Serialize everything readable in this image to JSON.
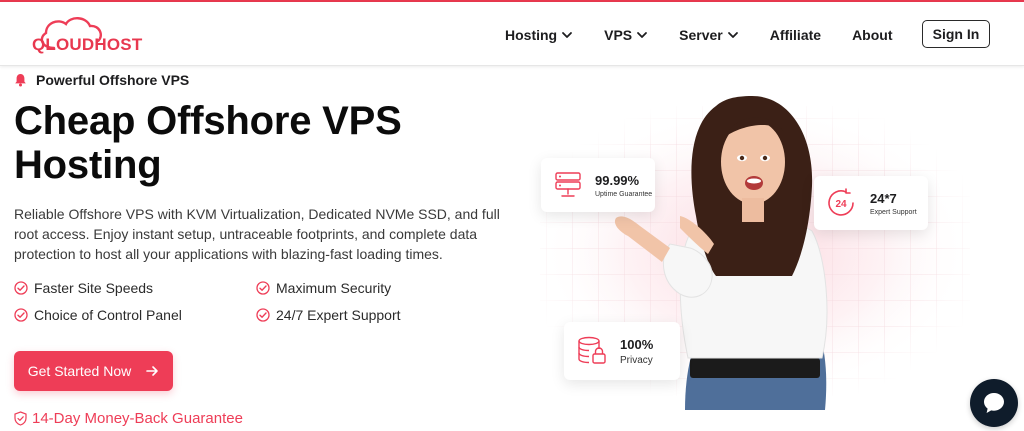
{
  "brand": {
    "logo_text": "QLOUDHOST",
    "accent": "#ee3d57",
    "dark": "#0f1c2b"
  },
  "nav": {
    "items": [
      {
        "label": "Hosting",
        "dropdown": true
      },
      {
        "label": "VPS",
        "dropdown": true
      },
      {
        "label": "Server",
        "dropdown": true
      },
      {
        "label": "Affiliate",
        "dropdown": false
      },
      {
        "label": "About",
        "dropdown": false
      }
    ],
    "signin_label": "Sign In"
  },
  "hero": {
    "eyebrow": "Powerful Offshore VPS",
    "title": "Cheap Offshore VPS Hosting",
    "description": "Reliable Offshore VPS with KVM Virtualization, Dedicated NVMe SSD, and full root access. Enjoy instant setup, untraceable footprints, and complete data protection to host all your applications with blazing-fast loading times.",
    "features": [
      "Faster Site Speeds",
      "Maximum Security",
      "Choice of Control Panel",
      "24/7 Expert Support"
    ],
    "cta_label": "Get Started Now",
    "guarantee": "14-Day Money-Back Guarantee"
  },
  "stats": {
    "uptime": {
      "value": "99.99%",
      "label": "Uptime Guarantee"
    },
    "support": {
      "value": "24*7",
      "label": "Expert Support",
      "badge": "24"
    },
    "privacy": {
      "value": "100%",
      "label": "Privacy"
    }
  },
  "icons": {
    "eyebrow": "bell-icon",
    "chevron": "chevron-down-icon",
    "feature": "check-circle-icon",
    "cta": "arrow-right-icon",
    "guarantee": "shield-check-icon",
    "uptime": "server-icon",
    "support": "24-hours-icon",
    "privacy": "database-lock-icon",
    "chat": "chat-bubble-icon"
  }
}
